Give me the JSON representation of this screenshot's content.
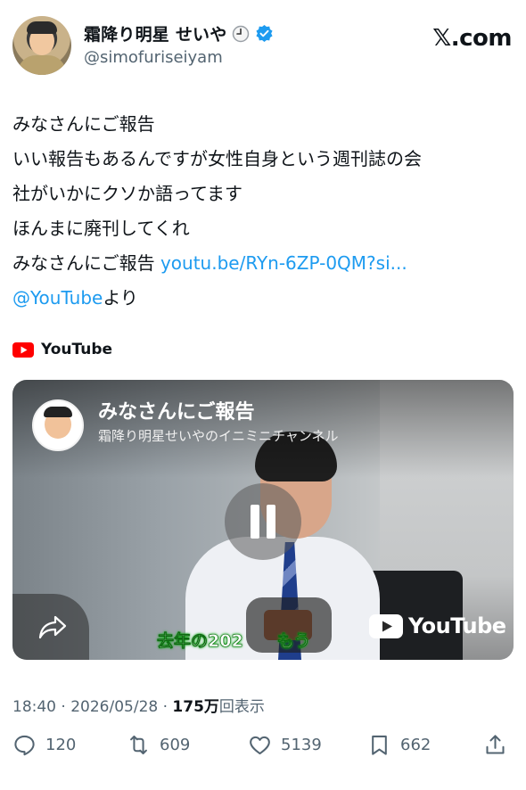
{
  "header": {
    "display_name": "霜降り明星 せいや",
    "handle": "@simofuriseiyam",
    "brand": "𝕏.com"
  },
  "tweet": {
    "lines": [
      "みなさんにご報告",
      "いい報告もあるんですが女性自身という週刊誌の会",
      "社がいかにクソか語ってます",
      "ほんまに廃刊してくれ"
    ],
    "line5_text": "みなさんにご報告 ",
    "line5_link": "youtu.be/RYn-6ZP-0QM?si...",
    "mention": "@YouTube",
    "mention_suffix": "より"
  },
  "source": {
    "label": "YouTube"
  },
  "video": {
    "title": "みなさんにご報告",
    "channel": "霜降り明星せいやのイニミニチャンネル",
    "subtitle": "去年の202　　もう",
    "watermark": "YouTube"
  },
  "meta": {
    "time": "18:40",
    "date": "2026/05/28",
    "views": "175万",
    "views_label": "回表示"
  },
  "actions": {
    "replies": "120",
    "reposts": "609",
    "likes": "5139",
    "bookmarks": "662"
  },
  "colors": {
    "link": "#1d9bf0",
    "verified": "#1d9bf0",
    "youtube_red": "#ff0000",
    "secondary_text": "#536471"
  }
}
